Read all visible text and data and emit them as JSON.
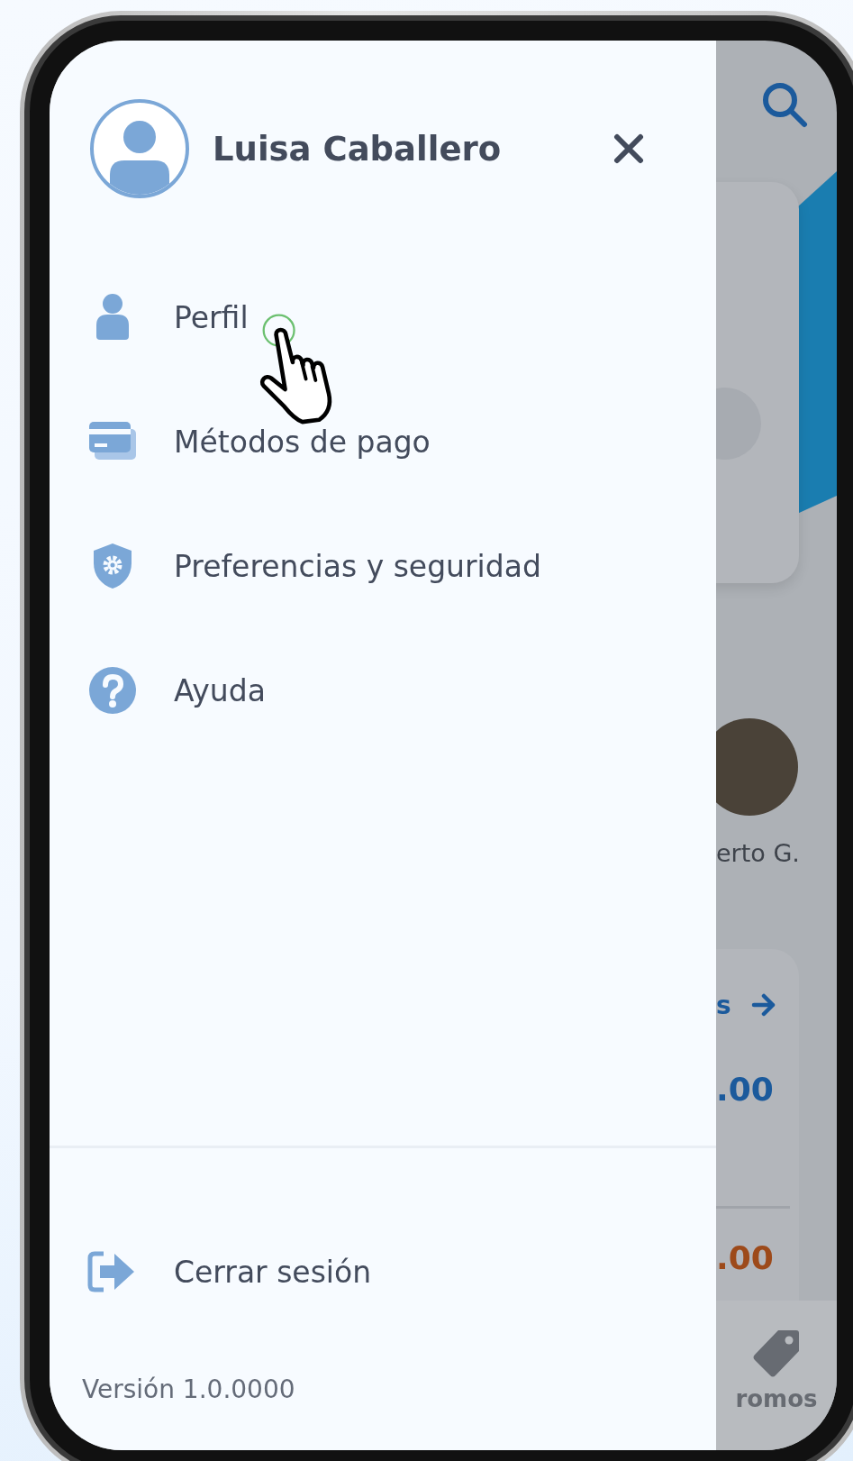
{
  "drawer": {
    "user_name": "Luisa Caballero",
    "items": [
      {
        "label": "Perfil"
      },
      {
        "label": "Métodos de pago"
      },
      {
        "label": "Preferencias y seguridad"
      },
      {
        "label": "Ayuda"
      }
    ],
    "logout": "Cerrar sesión",
    "version": "Versión 1.0.0000"
  },
  "background_screen": {
    "friend_name": "erto G.",
    "card_link": "s",
    "amount_1": ".00",
    "amount_2": ".00",
    "nav_label": "romos"
  }
}
